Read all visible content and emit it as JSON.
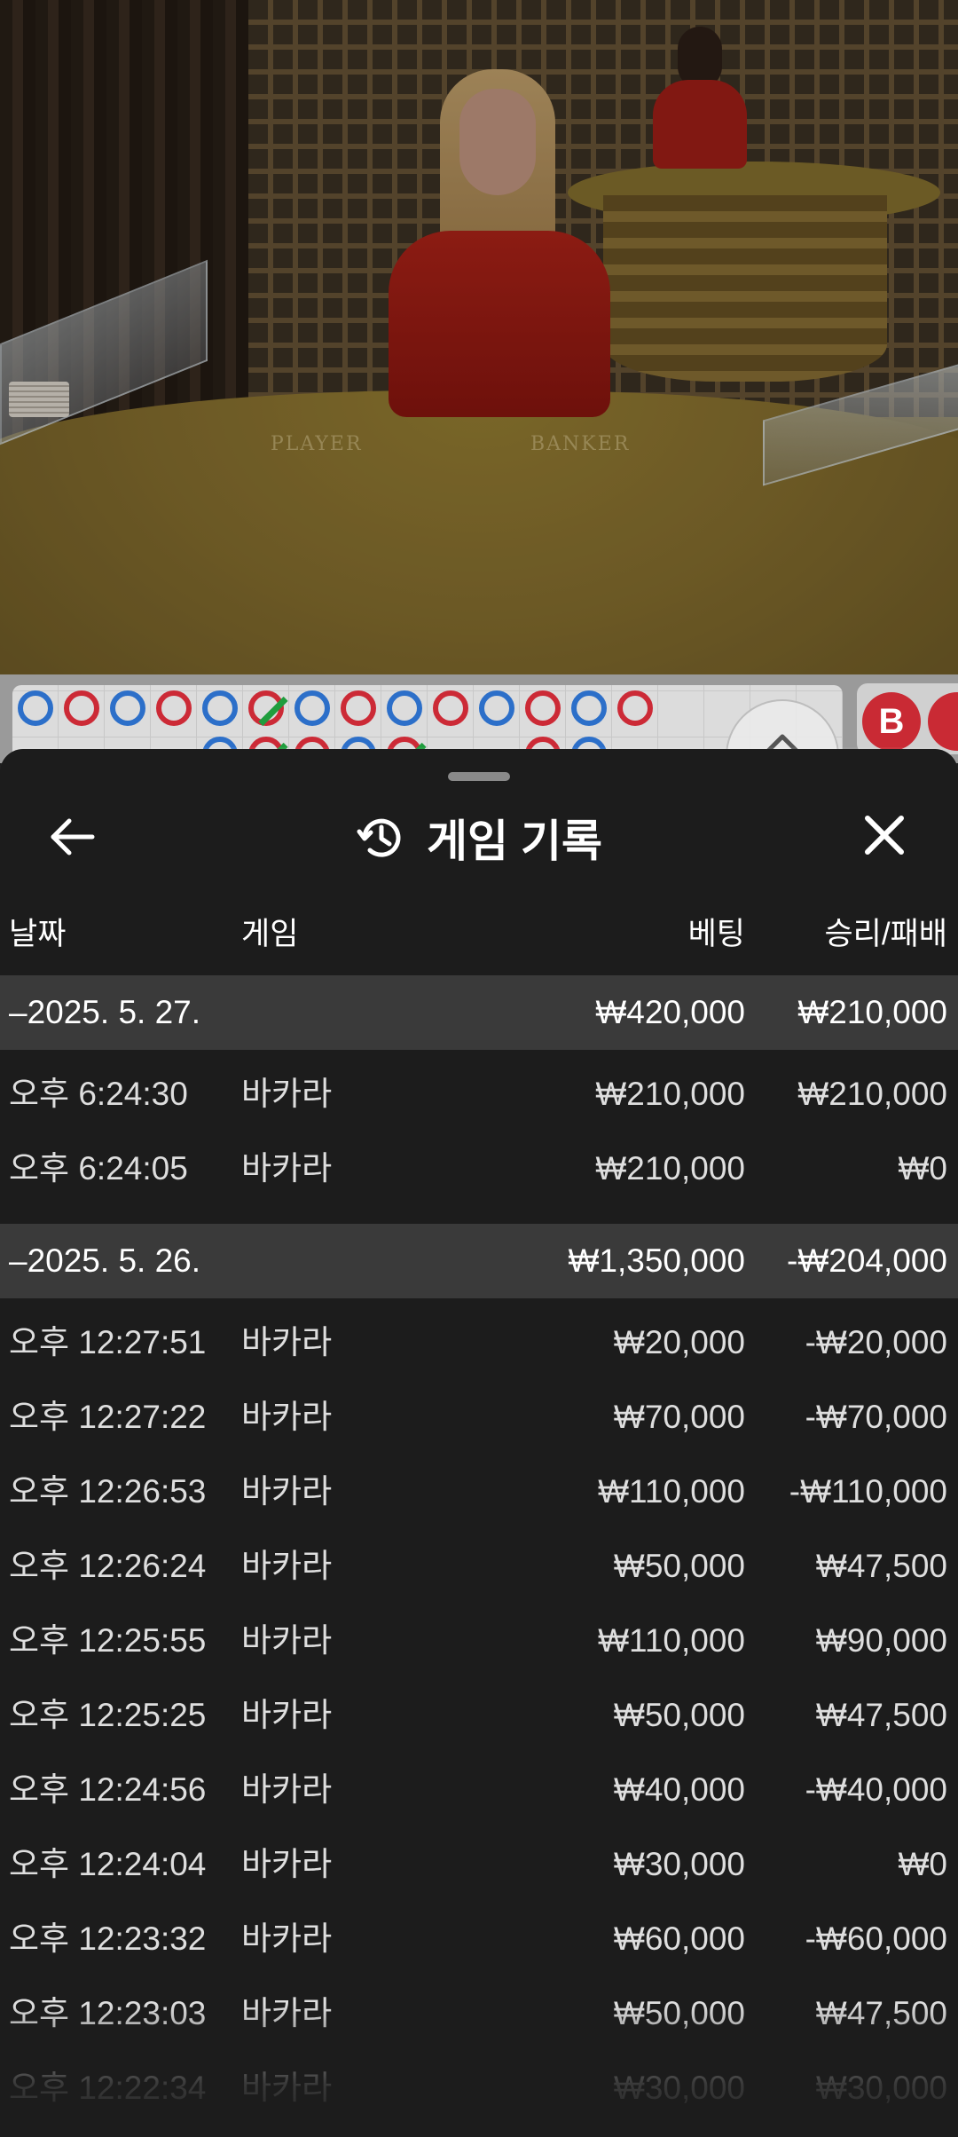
{
  "video": {
    "player_label": "PLAYER",
    "banker_label": "BANKER"
  },
  "roadmap": {
    "beads_row1": [
      "blue",
      "red",
      "blue",
      "red",
      "blue",
      "red-tie",
      "blue",
      "red",
      "blue",
      "red",
      "blue",
      "red",
      "blue",
      "red"
    ],
    "beads_row2": [
      "blue",
      "red-tie",
      "red",
      "blue",
      "red-tie",
      "red",
      "blue"
    ],
    "side_badge": "B"
  },
  "header": {
    "title": "게임 기록",
    "history_icon": "history-icon",
    "back_icon": "arrow-left-icon",
    "close_icon": "close-icon"
  },
  "columns": {
    "date": "날짜",
    "game": "게임",
    "bet": "베팅",
    "result": "승리/패배"
  },
  "groups": [
    {
      "date": "–2025. 5. 27.",
      "bet": "₩420,000",
      "result": "₩210,000",
      "rows": [
        {
          "time": "오후 6:24:30",
          "game": "바카라",
          "bet": "₩210,000",
          "result": "₩210,000"
        },
        {
          "time": "오후 6:24:05",
          "game": "바카라",
          "bet": "₩210,000",
          "result": "₩0"
        }
      ]
    },
    {
      "date": "–2025. 5. 26.",
      "bet": "₩1,350,000",
      "result": "-₩204,000",
      "rows": [
        {
          "time": "오후 12:27:51",
          "game": "바카라",
          "bet": "₩20,000",
          "result": "-₩20,000"
        },
        {
          "time": "오후 12:27:22",
          "game": "바카라",
          "bet": "₩70,000",
          "result": "-₩70,000"
        },
        {
          "time": "오후 12:26:53",
          "game": "바카라",
          "bet": "₩110,000",
          "result": "-₩110,000"
        },
        {
          "time": "오후 12:26:24",
          "game": "바카라",
          "bet": "₩50,000",
          "result": "₩47,500"
        },
        {
          "time": "오후 12:25:55",
          "game": "바카라",
          "bet": "₩110,000",
          "result": "₩90,000"
        },
        {
          "time": "오후 12:25:25",
          "game": "바카라",
          "bet": "₩50,000",
          "result": "₩47,500"
        },
        {
          "time": "오후 12:24:56",
          "game": "바카라",
          "bet": "₩40,000",
          "result": "-₩40,000"
        },
        {
          "time": "오후 12:24:04",
          "game": "바카라",
          "bet": "₩30,000",
          "result": "₩0"
        },
        {
          "time": "오후 12:23:32",
          "game": "바카라",
          "bet": "₩60,000",
          "result": "-₩60,000"
        },
        {
          "time": "오후 12:23:03",
          "game": "바카라",
          "bet": "₩50,000",
          "result": "₩47,500"
        },
        {
          "time": "오후 12:22:34",
          "game": "바카라",
          "bet": "₩30,000",
          "result": "₩30,000"
        }
      ]
    }
  ]
}
